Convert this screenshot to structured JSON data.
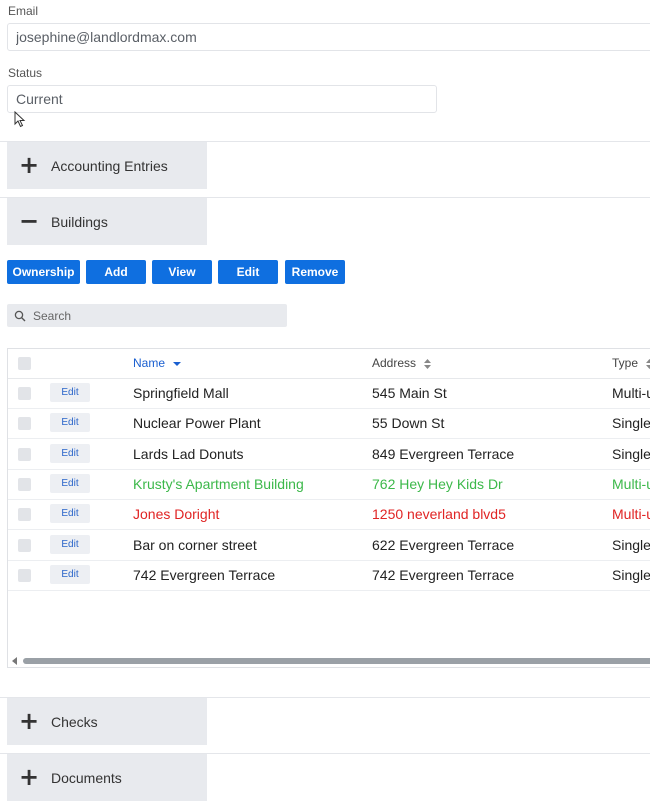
{
  "email": {
    "label": "Email",
    "value": "josephine@landlordmax.com"
  },
  "status": {
    "label": "Status",
    "value": "Current"
  },
  "sections": {
    "accounting": {
      "symbol": "+",
      "title": "Accounting Entries"
    },
    "buildings": {
      "symbol": "−",
      "title": "Buildings"
    },
    "checks": {
      "symbol": "+",
      "title": "Checks"
    },
    "documents": {
      "symbol": "+",
      "title": "Documents"
    }
  },
  "toolbar": {
    "ownership": "Ownership",
    "add": "Add",
    "view": "View",
    "edit": "Edit",
    "remove": "Remove"
  },
  "search": {
    "placeholder": "Search"
  },
  "table": {
    "columns": {
      "name": "Name",
      "address": "Address",
      "type": "Type"
    },
    "edit_label": "Edit",
    "rows": [
      {
        "name": "Springfield Mall",
        "address": "545 Main St",
        "type": "Multi-unit",
        "color": "#222222"
      },
      {
        "name": "Nuclear Power Plant",
        "address": "55 Down St",
        "type": "Single",
        "color": "#222222"
      },
      {
        "name": "Lards Lad Donuts",
        "address": "849 Evergreen Terrace",
        "type": "Single",
        "color": "#222222"
      },
      {
        "name": "Krusty's Apartment Building",
        "address": "762 Hey Hey Kids Dr",
        "type": "Multi-unit",
        "color": "#3cb84a"
      },
      {
        "name": "Jones Doright",
        "address": "1250 neverland blvd5",
        "type": "Multi-unit",
        "color": "#e02424"
      },
      {
        "name": "Bar on corner street",
        "address": "622 Evergreen Terrace",
        "type": "Single",
        "color": "#222222"
      },
      {
        "name": "742 Evergreen Terrace",
        "address": "742 Evergreen Terrace",
        "type": "Single",
        "color": "#222222"
      }
    ]
  },
  "colors": {
    "primary_button": "#0f6fe0",
    "link": "#1a5fd0",
    "section_bg": "#e8eaee"
  }
}
